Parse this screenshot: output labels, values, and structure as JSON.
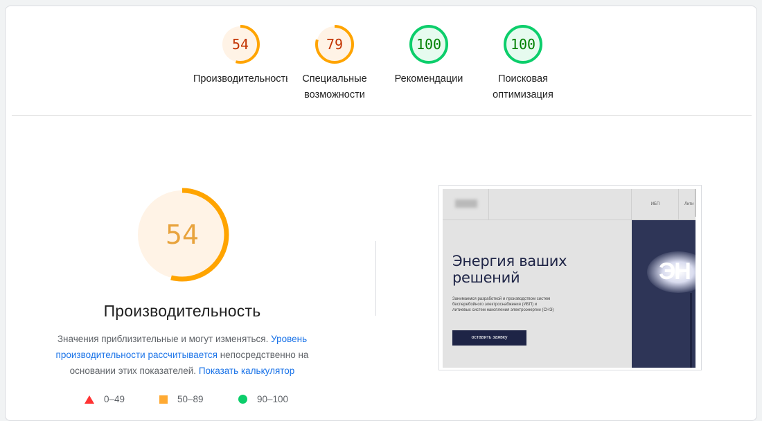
{
  "categories": [
    {
      "score": "54",
      "label": "Производительность",
      "color": "#ffa400",
      "text_color": "#c33300",
      "fill": "#fff3e6",
      "fraction": 0.54
    },
    {
      "score": "79",
      "label": "Специальные возможности",
      "color": "#ffa400",
      "text_color": "#c33300",
      "fill": "#fff3e6",
      "fraction": 0.79
    },
    {
      "score": "100",
      "label": "Рекомендации",
      "color": "#0cce6b",
      "text_color": "#008000",
      "fill": "#e6fbef",
      "fraction": 1.0
    },
    {
      "score": "100",
      "label": "Поисковая оптимизация",
      "color": "#0cce6b",
      "text_color": "#008000",
      "fill": "#e6fbef",
      "fraction": 1.0
    }
  ],
  "main": {
    "score": "54",
    "fraction": 0.54,
    "title": "Производительность",
    "desc_text_1": "Значения приблизительные и могут изменяться. ",
    "desc_link_1": "Уровень производительности рассчитывается",
    "desc_text_2": " непосредственно на основании этих показателей. ",
    "desc_link_2": "Показать калькулятор"
  },
  "legend": [
    {
      "range": "0–49",
      "icon": "triangle-icon",
      "color": "#ff3333"
    },
    {
      "range": "50–89",
      "icon": "square-icon",
      "color": "#ffaa33"
    },
    {
      "range": "90–100",
      "icon": "circle-icon",
      "color": "#0cce6b"
    }
  ],
  "screenshot": {
    "nav_item_1": "ИБП",
    "nav_item_2": "Лити",
    "hero_title": "Энергия ваших решений",
    "hero_text": "Занимаемся разработкой и производством систем бесперебойного электроснабжения (ИБП) и литиевых систем накопления электроэнергии (СНЭ)",
    "cta_label": "оставить заявку",
    "glow_text": "ЭН"
  }
}
